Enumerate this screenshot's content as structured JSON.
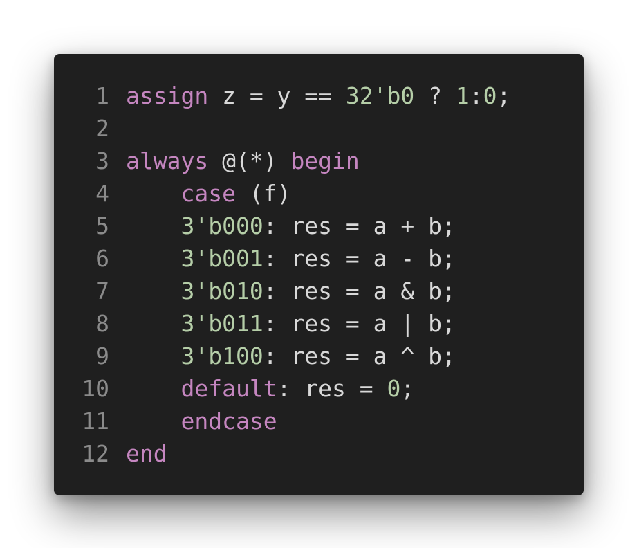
{
  "theme": {
    "background": "#1f1f1f",
    "keyword": "#c586c0",
    "number": "#b5cea8",
    "plain": "#d8d8d8",
    "line_number": "#8b8b8b"
  },
  "code": {
    "lines": [
      {
        "number": "1",
        "tokens": [
          {
            "t": "assign",
            "k": "kw"
          },
          {
            "t": " z = y ",
            "k": "plain"
          },
          {
            "t": "==",
            "k": "plain"
          },
          {
            "t": " ",
            "k": "plain"
          },
          {
            "t": "32'b0",
            "k": "num"
          },
          {
            "t": " ? ",
            "k": "plain"
          },
          {
            "t": "1",
            "k": "num"
          },
          {
            "t": ":",
            "k": "plain"
          },
          {
            "t": "0",
            "k": "num"
          },
          {
            "t": ";",
            "k": "plain"
          }
        ]
      },
      {
        "number": "2",
        "tokens": []
      },
      {
        "number": "3",
        "tokens": [
          {
            "t": "always",
            "k": "kw"
          },
          {
            "t": " @(*) ",
            "k": "plain"
          },
          {
            "t": "begin",
            "k": "kw"
          }
        ]
      },
      {
        "number": "4",
        "tokens": [
          {
            "t": "    ",
            "k": "plain"
          },
          {
            "t": "case",
            "k": "kw"
          },
          {
            "t": " (f)",
            "k": "plain"
          }
        ]
      },
      {
        "number": "5",
        "tokens": [
          {
            "t": "    ",
            "k": "plain"
          },
          {
            "t": "3'b000",
            "k": "num"
          },
          {
            "t": ": res = a + b;",
            "k": "plain"
          }
        ]
      },
      {
        "number": "6",
        "tokens": [
          {
            "t": "    ",
            "k": "plain"
          },
          {
            "t": "3'b001",
            "k": "num"
          },
          {
            "t": ": res = a - b;",
            "k": "plain"
          }
        ]
      },
      {
        "number": "7",
        "tokens": [
          {
            "t": "    ",
            "k": "plain"
          },
          {
            "t": "3'b010",
            "k": "num"
          },
          {
            "t": ": res = a & b;",
            "k": "plain"
          }
        ]
      },
      {
        "number": "8",
        "tokens": [
          {
            "t": "    ",
            "k": "plain"
          },
          {
            "t": "3'b011",
            "k": "num"
          },
          {
            "t": ": res = a | b;",
            "k": "plain"
          }
        ]
      },
      {
        "number": "9",
        "tokens": [
          {
            "t": "    ",
            "k": "plain"
          },
          {
            "t": "3'b100",
            "k": "num"
          },
          {
            "t": ": res = a ^ b;",
            "k": "plain"
          }
        ]
      },
      {
        "number": "10",
        "tokens": [
          {
            "t": "    ",
            "k": "plain"
          },
          {
            "t": "default",
            "k": "kw"
          },
          {
            "t": ": res = ",
            "k": "plain"
          },
          {
            "t": "0",
            "k": "num"
          },
          {
            "t": ";",
            "k": "plain"
          }
        ]
      },
      {
        "number": "11",
        "tokens": [
          {
            "t": "    ",
            "k": "plain"
          },
          {
            "t": "endcase",
            "k": "kw"
          }
        ]
      },
      {
        "number": "12",
        "tokens": [
          {
            "t": "end",
            "k": "kw"
          }
        ]
      }
    ]
  }
}
